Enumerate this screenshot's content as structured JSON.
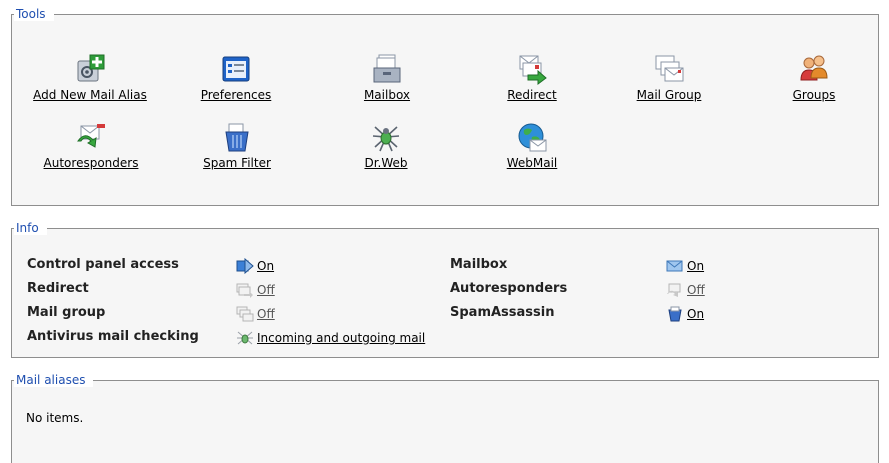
{
  "tools": {
    "legend": "Tools",
    "items": [
      {
        "label": "Add New Mail Alias",
        "icon": "add-mail-alias-icon"
      },
      {
        "label": "Preferences",
        "icon": "preferences-icon"
      },
      {
        "label": "Mailbox",
        "icon": "mailbox-icon"
      },
      {
        "label": "Redirect",
        "icon": "redirect-icon"
      },
      {
        "label": "Mail Group",
        "icon": "mail-group-icon"
      },
      {
        "label": "Groups",
        "icon": "groups-icon"
      },
      {
        "label": "Autoresponders",
        "icon": "autoresponders-icon"
      },
      {
        "label": "Spam Filter",
        "icon": "spam-filter-icon"
      },
      {
        "label": "Dr.Web",
        "icon": "drweb-icon"
      },
      {
        "label": "WebMail",
        "icon": "webmail-icon"
      }
    ]
  },
  "info": {
    "legend": "Info",
    "rows": [
      {
        "label": "Control panel access",
        "value": "On",
        "icon": "control-panel-icon",
        "state": "on"
      },
      {
        "label": "Redirect",
        "value": "Off",
        "icon": "redirect-icon",
        "state": "off"
      },
      {
        "label": "Mail group",
        "value": "Off",
        "icon": "mail-group-icon",
        "state": "off"
      },
      {
        "label": "Antivirus mail checking",
        "value": "Incoming and outgoing mail",
        "icon": "antivirus-icon",
        "state": "on"
      },
      {
        "label": "Mailbox",
        "value": "On",
        "icon": "mailbox-icon",
        "state": "on"
      },
      {
        "label": "Autoresponders",
        "value": "Off",
        "icon": "autoresponders-icon",
        "state": "off"
      },
      {
        "label": "SpamAssassin",
        "value": "On",
        "icon": "spamassassin-icon",
        "state": "on"
      }
    ]
  },
  "aliases": {
    "legend": "Mail aliases",
    "empty_text": "No items."
  }
}
